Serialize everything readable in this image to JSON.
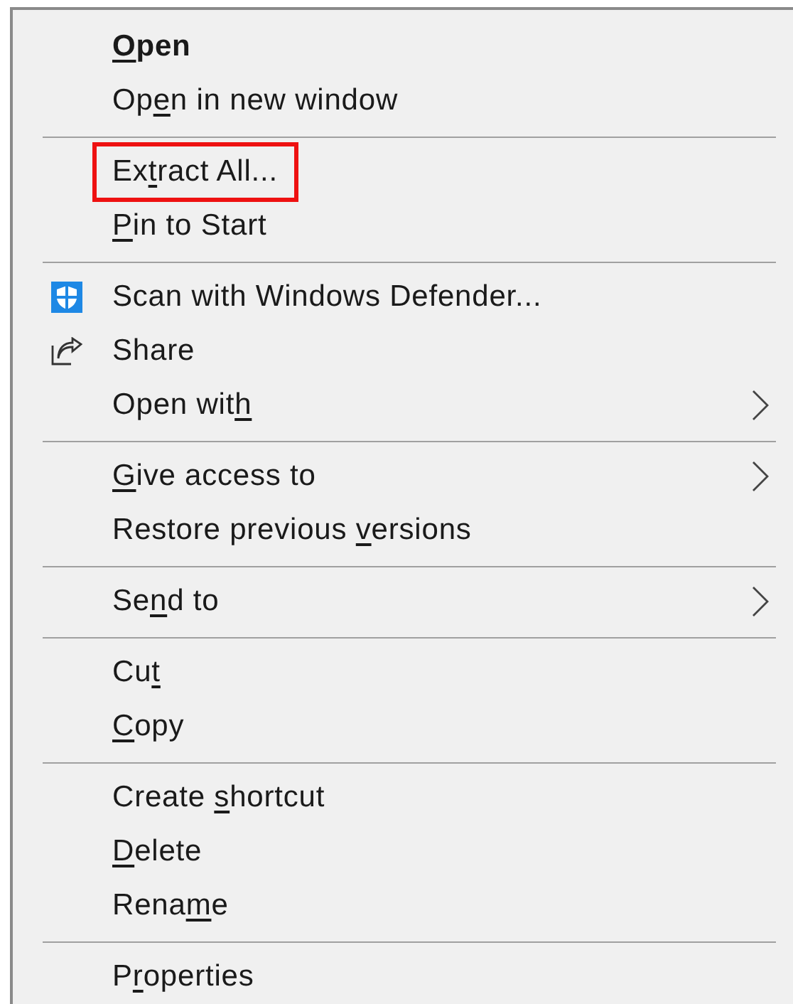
{
  "menu": {
    "items": [
      {
        "kind": "item",
        "key": "O",
        "post": "pen",
        "bold": true,
        "highlighted": false,
        "submenu": false
      },
      {
        "kind": "item",
        "pre": "Op",
        "key": "e",
        "post": "n in new window",
        "bold": false,
        "highlighted": false,
        "submenu": false
      },
      {
        "kind": "separator"
      },
      {
        "kind": "item",
        "pre": "Ex",
        "key": "t",
        "post": "ract All...",
        "bold": false,
        "highlighted": true,
        "submenu": false
      },
      {
        "kind": "item",
        "key": "P",
        "post": "in to Start",
        "bold": false,
        "highlighted": false,
        "submenu": false
      },
      {
        "kind": "separator"
      },
      {
        "kind": "shield",
        "pre": "Scan with Windows Defender...",
        "bold": false,
        "highlighted": false,
        "submenu": false
      },
      {
        "kind": "share",
        "pre": "Share",
        "bold": false,
        "highlighted": false,
        "submenu": false
      },
      {
        "kind": "item",
        "pre": "Open wit",
        "key": "h",
        "bold": false,
        "highlighted": false,
        "submenu": true
      },
      {
        "kind": "separator"
      },
      {
        "kind": "item",
        "key": "G",
        "post": "ive access to",
        "bold": false,
        "highlighted": false,
        "submenu": true
      },
      {
        "kind": "item",
        "pre": "Restore previous ",
        "key": "v",
        "post": "ersions",
        "bold": false,
        "highlighted": false,
        "submenu": false
      },
      {
        "kind": "separator"
      },
      {
        "kind": "item",
        "pre": "Se",
        "key": "n",
        "post": "d to",
        "bold": false,
        "highlighted": false,
        "submenu": true
      },
      {
        "kind": "separator"
      },
      {
        "kind": "item",
        "pre": "Cu",
        "key": "t",
        "bold": false,
        "highlighted": false,
        "submenu": false
      },
      {
        "kind": "item",
        "key": "C",
        "post": "opy",
        "bold": false,
        "highlighted": false,
        "submenu": false
      },
      {
        "kind": "separator"
      },
      {
        "kind": "item",
        "pre": "Create ",
        "key": "s",
        "post": "hortcut",
        "bold": false,
        "highlighted": false,
        "submenu": false
      },
      {
        "kind": "item",
        "key": "D",
        "post": "elete",
        "bold": false,
        "highlighted": false,
        "submenu": false
      },
      {
        "kind": "item",
        "pre": "Rena",
        "key": "m",
        "post": "e",
        "bold": false,
        "highlighted": false,
        "submenu": false
      },
      {
        "kind": "separator"
      },
      {
        "kind": "item",
        "pre": "P",
        "key": "r",
        "post": "operties",
        "bold": false,
        "highlighted": false,
        "submenu": false
      }
    ]
  }
}
